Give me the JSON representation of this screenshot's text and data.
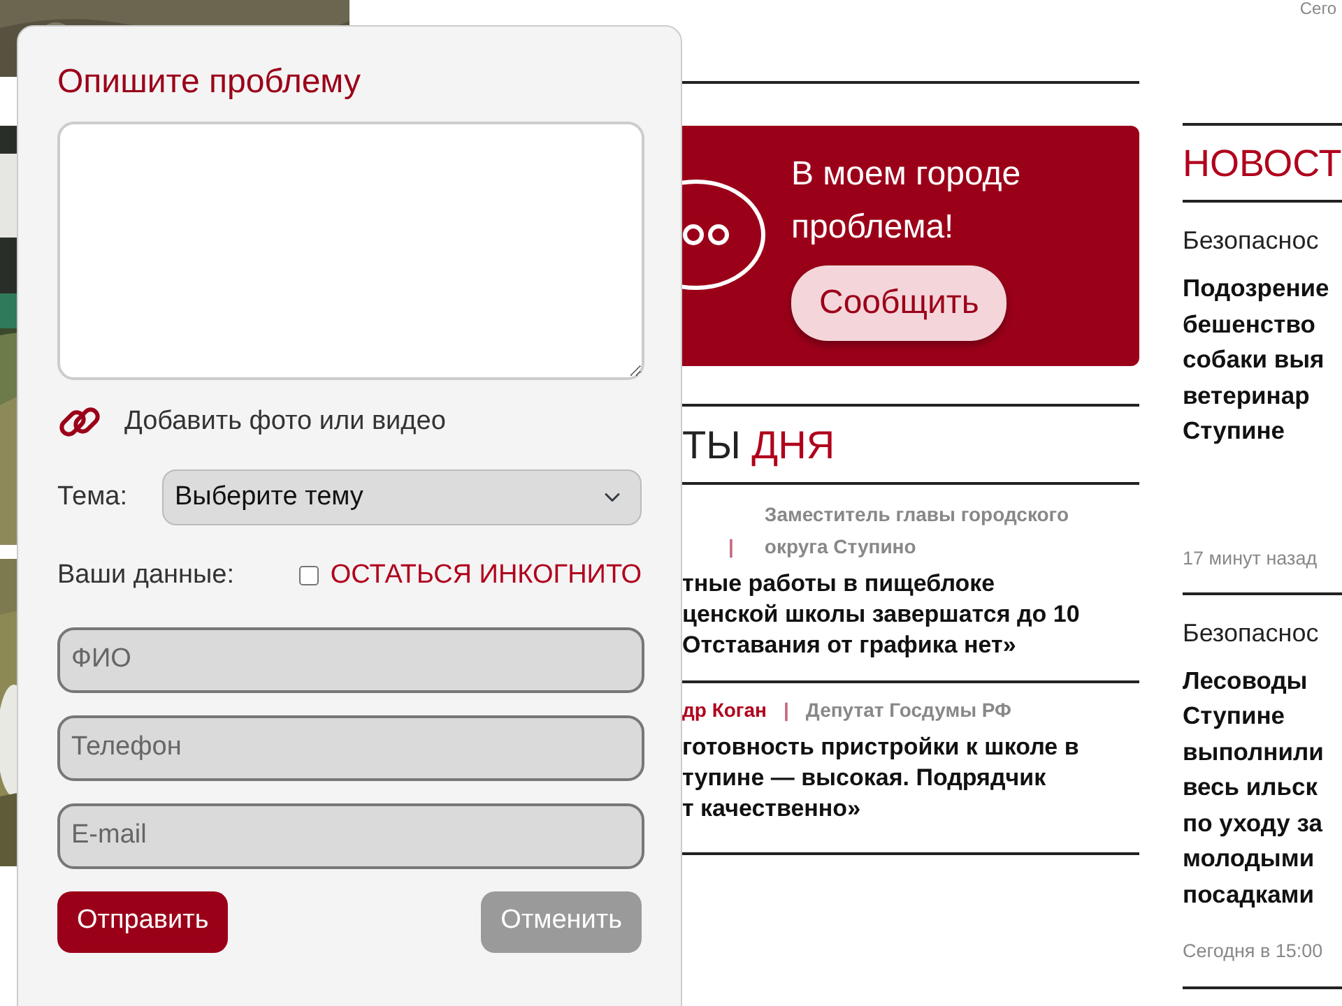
{
  "corner_text": "Сего",
  "modal": {
    "title": "Опишите проблему",
    "attach_label": "Добавить фото или видео",
    "topic": {
      "label": "Тема:",
      "value": "Выберите тему"
    },
    "your_data_label": "Ваши данные:",
    "incognito": {
      "label": "ОСТАТЬСЯ ИНКОГНИТО",
      "checked": false
    },
    "fields": [
      {
        "placeholder": "ФИО"
      },
      {
        "placeholder": "Телефон"
      },
      {
        "placeholder": "E-mail"
      }
    ],
    "buttons": [
      {
        "label": "Отправить",
        "disabled": false
      },
      {
        "label": "Отменить",
        "disabled": true
      }
    ]
  },
  "banner": {
    "lines": [
      "В моем городе",
      "проблема!"
    ],
    "button": "Сообщить"
  },
  "quotes": {
    "title": [
      {
        "text": "ТЫ",
        "accent": false
      },
      {
        "text": "ДНЯ",
        "accent": true
      }
    ],
    "items": [
      {
        "separator": "|",
        "position": "Заместитель главы городского округа Ступино",
        "headline_lines": [
          "тные работы в пищеблоке",
          "ценской школы завершатся до 10",
          "Отставания от графика нет»"
        ]
      },
      {
        "author": "др Коган",
        "separator": "|",
        "position": "Депутат Госдумы РФ",
        "headline_lines": [
          "готовность пристройки к школе в",
          "тупине — высокая. Подрядчик",
          "т качественно»"
        ]
      }
    ]
  },
  "news": {
    "title": "НОВОСТ",
    "items": [
      {
        "category": "Безопаснос",
        "title_lines": [
          "Подозрение",
          "бешенство",
          "собаки выя",
          "ветеринар",
          "Ступине"
        ],
        "time": "17 минут назад"
      },
      {
        "category": "Безопаснос",
        "title_lines": [
          "Лесоводы",
          "Ступине",
          "выполнили",
          "весь ильск",
          "по уходу за",
          "молодыми",
          "посадками"
        ],
        "time": "Сегодня в 15:00"
      }
    ]
  }
}
